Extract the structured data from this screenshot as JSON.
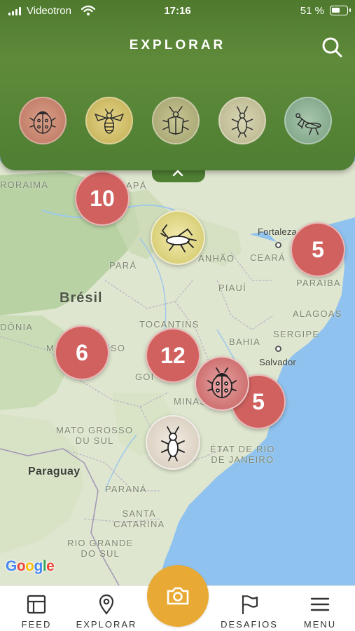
{
  "status_bar": {
    "carrier": "Videotron",
    "time": "17:16",
    "battery": "51 %"
  },
  "header": {
    "title": "EXPLORAR",
    "search_icon": "search-icon",
    "categories": [
      {
        "name": "ladybug",
        "icon": "ladybug-icon",
        "color": "#c07a64"
      },
      {
        "name": "bee",
        "icon": "bee-icon",
        "color": "#c7b35a"
      },
      {
        "name": "beetle",
        "icon": "beetle-icon",
        "color": "#a7a673"
      },
      {
        "name": "cricket",
        "icon": "cricket-icon",
        "color": "#bcb990"
      },
      {
        "name": "mantis",
        "icon": "mantis-icon",
        "color": "#7fa588"
      }
    ]
  },
  "map": {
    "labels": {
      "roraima": "RORAIMA",
      "amapa": "APÁ",
      "fortaleza": "Fortaleza",
      "maranhao": "ANHÃO",
      "ceara": "CEARÁ",
      "para": "PARÁ",
      "piaui": "PIAUÍ",
      "paraiba": "PARAIBA",
      "bresil": "Brésil",
      "alagoas": "ALAGOAS",
      "rondonia": "DÔNIA",
      "tocantins": "TOCANTINS",
      "sergipe": "SERGIPE",
      "bahia": "BAHIA",
      "mato_grosso": "M",
      "mato_grosso_tail": "SO",
      "salvador": "Salvador",
      "goias": "GOI",
      "minas": "MINAS",
      "mato_grosso_sul": "MATO GROSSO\nDU SUL",
      "rio": "ÉTAT DE RIO\nDE JANEIRO",
      "paraguay": "Paraguay",
      "parana": "PARANÁ",
      "santa_catarina": "SANTA\nCATARINA",
      "rio_grande": "RIO GRANDE\nDO SUL"
    },
    "clusters": [
      {
        "id": "cluster-north",
        "count": "10"
      },
      {
        "id": "cluster-east",
        "count": "5"
      },
      {
        "id": "cluster-west",
        "count": "6"
      },
      {
        "id": "cluster-center",
        "count": "12"
      },
      {
        "id": "cluster-southeast",
        "count": "5"
      }
    ],
    "pins": [
      {
        "id": "pin-cricket",
        "icon": "cricket-icon",
        "color": "#d6cc72"
      },
      {
        "id": "pin-ladybug",
        "icon": "ladybug-icon",
        "color": "#cc6a6a"
      },
      {
        "id": "pin-beetle",
        "icon": "beetle-icon",
        "color": "#d9cfc0"
      }
    ],
    "attribution": "Google"
  },
  "bottom_nav": {
    "items": [
      {
        "label": "FEED",
        "icon": "feed-icon"
      },
      {
        "label": "EXPLORAR",
        "icon": "map-pin-icon"
      },
      {
        "label": "DESAFIOS",
        "icon": "flag-icon"
      },
      {
        "label": "MENU",
        "icon": "menu-icon"
      }
    ],
    "camera_icon": "camera-icon",
    "camera_color": "#e9aa35"
  }
}
